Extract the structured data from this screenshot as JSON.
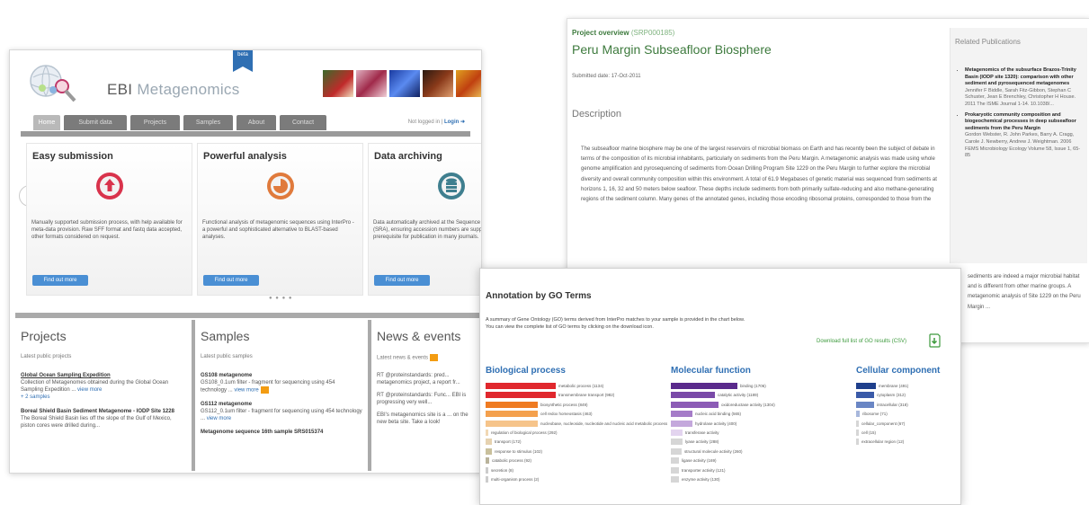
{
  "home": {
    "brand_ebi": "EBI",
    "brand_meta": "Metagenomics",
    "beta": "beta",
    "tabs": [
      "Home",
      "Submit data",
      "Projects",
      "Samples",
      "About",
      "Contact"
    ],
    "login_text": "Not logged in | ",
    "login_link": "Login",
    "cards": [
      {
        "title": "Easy submission",
        "desc": "Manually supported submission process, with help available for meta-data provision. Raw SFF format and fastq data accepted, other formats considered on request.",
        "button": "Find out more",
        "color": "#d9334c"
      },
      {
        "title": "Powerful analysis",
        "desc": "Functional analysis of metagenomic sequences using InterPro - a powerful and sophisticated alternative to BLAST-based analyses.",
        "button": "Find out more",
        "color": "#e07a3c"
      },
      {
        "title": "Data archiving",
        "desc": "Data automatically archived at the Sequence Read Archive (SRA), ensuring accession numbers are supplied - a prerequisite for publication in many journals.",
        "button": "Find out more",
        "color": "#3f7f8f"
      }
    ],
    "arrow_left": "‹",
    "arrow_right": "›",
    "dots": "● ● ● ●",
    "projects": {
      "title": "Projects",
      "sub": "Latest public projects",
      "item1_title": "Global Ocean Sampling Expedition",
      "item1_desc": "Collection of Metagenomes obtained during the Global Ocean Sampling Expedition ...",
      "item1_more": "view more",
      "item1_samples": "+ 2 samples",
      "item2_title": "Boreal Shield Basin Sediment Metagenome - IODP Site 1228",
      "item2_desc": "The Boreal Shield Basin lies off the slope of the Gulf of Mexico, piston cores were drilled during..."
    },
    "samples": {
      "title": "Samples",
      "sub": "Latest public samples",
      "s1_title": "GS108 metagenome",
      "s1_desc": "GS108_0.1um filter - fragment for sequencing using 454 technology ...",
      "s1_more": "view more",
      "s2_title": "GS112 metagenome",
      "s2_desc": "GS112_0.1um filter - fragment for sequencing using 454 technology ...",
      "s2_more": "view more",
      "s3_title": "Metagenome sequence 16th sample SRS015374"
    },
    "news": {
      "title": "News & events",
      "sub": "Latest news & events",
      "n1": "RT @proteinstandards: pred... metagenomics project, a report fr...",
      "n2": "RT @proteinstandards: Func... EBI is progressing very well...",
      "n3": "EBI's metagenomics site is a ... on the new beta site. Take a look!"
    }
  },
  "project": {
    "overview_label": "Project overview",
    "overview_id": "(SRP000185)",
    "title": "Peru Margin Subseafloor Biosphere",
    "submitted": "Submitted date: 17-Oct-2011",
    "description_head": "Description",
    "description": "The subseafloor marine biosphere may be one of the largest reservoirs of microbial biomass on Earth and has recently been the subject of debate in terms of the composition of its microbial inhabitants, particularly on sediments from the Peru Margin. A metagenomic analysis was made using whole genome amplification and pyrosequencing of sediments from Ocean Drilling Program Site 1229 on the Peru Margin to further explore the microbial diversity and overall community composition within this environment. A total of 61.9 Megabases of genetic material was sequenced from sediments at horizons 1, 16, 32 and 50 meters below seafloor. These depths include sediments from both primarily sulfate-reducing and also methane-generating regions of the sediment column. Many genes of the annotated genes, including those encoding ribosomal proteins, corresponded to those from the",
    "related_head": "Related Publications",
    "pubs": [
      {
        "title": "Metagenomics of the subsurface Brazos-Trinity Basin (IODP site 1320): comparison with other sediment and pyrosequenced metagenomes",
        "meta": "Jennifer F Biddle, Sarah Fitz-Gibbon, Stephan C Schuster, Jean E Brenchley, Christopher H House. 2011 The ISME Journal 1-14. 10.1038/..."
      },
      {
        "title": "Prokaryotic community composition and biogeochemical processes in deep subseafloor sediments from the Peru Margin",
        "meta": "Gordon Webster, R. John Parkes, Barry A. Cragg, Carole J. Newberry, Andrew J. Weightman. 2006 FEMS Microbiology Ecology Volume 58, Issue 1, 65-85"
      }
    ],
    "tail": "sediments are indeed a major microbial habitat and is different from other marine groups. A metagenomic analysis of Site 1229 on the Peru Margin ..."
  },
  "go": {
    "title": "Annotation by GO Terms",
    "desc1": "A summary of Gene Ontology (GO) terms derived from InterPro matches to your sample is provided in the chart below.",
    "desc2": "You can view the complete list of GO terms by clicking on the download icon.",
    "download": "Download full list of GO results (CSV)",
    "sections": [
      {
        "title": "Biological process",
        "color": "#2f6fb3",
        "items": [
          {
            "label": "metabolic process (1134)",
            "value": 1.0,
            "color": "#e0272d"
          },
          {
            "label": "transmembrane transport (982)",
            "value": 1.0,
            "color": "#e0272d"
          },
          {
            "label": "biosynthetic process (849)",
            "value": 0.74,
            "color": "#ef7b22"
          },
          {
            "label": "cell redox homeostasis (463)",
            "value": 0.74,
            "color": "#f4a04d"
          },
          {
            "label": "nucleobase, nucleoside, nucleotide and nucleic acid metabolic process",
            "value": 0.74,
            "color": "#f6c48a"
          },
          {
            "label": "regulation of biological process (292)",
            "value": 0.02,
            "color": "#f1d8b4"
          },
          {
            "label": "transport (172)",
            "value": 0.09,
            "color": "#e6d2b0"
          },
          {
            "label": "response to stimulus (102)",
            "value": 0.09,
            "color": "#c9c09c"
          },
          {
            "label": "catabolic process (92)",
            "value": 0.05,
            "color": "#b9b39b"
          },
          {
            "label": "secretion (8)",
            "value": 0.0,
            "color": "#cccccc"
          },
          {
            "label": "multi-organism process (2)",
            "value": 0.0,
            "color": "#cccccc"
          }
        ]
      },
      {
        "title": "Molecular function",
        "color": "#2f6fb3",
        "items": [
          {
            "label": "binding (1706)",
            "value": 1.0,
            "color": "#5a2a8c"
          },
          {
            "label": "catalytic activity (1189)",
            "value": 0.66,
            "color": "#7a4aa8"
          },
          {
            "label": "oxidoreductase activity (1304)",
            "value": 0.71,
            "color": "#8c5cb6"
          },
          {
            "label": "nucleic acid binding (565)",
            "value": 0.33,
            "color": "#a57cc8"
          },
          {
            "label": "hydrolase activity (400)",
            "value": 0.33,
            "color": "#c4a8dc"
          },
          {
            "label": "transferase activity",
            "value": 0.17,
            "color": "#e3d4ef"
          },
          {
            "label": "lyase activity (288)",
            "value": 0.17,
            "color": "#d6d6d6"
          },
          {
            "label": "structural molecule activity (260)",
            "value": 0.16,
            "color": "#d6d6d6"
          },
          {
            "label": "ligase activity (169)",
            "value": 0.12,
            "color": "#d6d6d6"
          },
          {
            "label": "transporter activity (121)",
            "value": 0.12,
            "color": "#d6d6d6"
          },
          {
            "label": "enzyme activity (130)",
            "value": 0.12,
            "color": "#d6d6d6"
          }
        ]
      },
      {
        "title": "Cellular component",
        "color": "#2f6fb3",
        "items": [
          {
            "label": "membrane (491)",
            "value": 1.0,
            "color": "#1f3f8c"
          },
          {
            "label": "cytoplasm (312)",
            "value": 0.9,
            "color": "#3a5aa8"
          },
          {
            "label": "intracellular (318)",
            "value": 0.9,
            "color": "#6a86c4"
          },
          {
            "label": "ribosome (71)",
            "value": 0.2,
            "color": "#a8b8dc"
          },
          {
            "label": "cellular_component (67)",
            "value": 0.02,
            "color": "#d6d6d6"
          },
          {
            "label": "cell (15)",
            "value": 0.02,
            "color": "#d6d6d6"
          },
          {
            "label": "extracellular region (12)",
            "value": 0.02,
            "color": "#d6d6d6"
          }
        ]
      }
    ]
  }
}
